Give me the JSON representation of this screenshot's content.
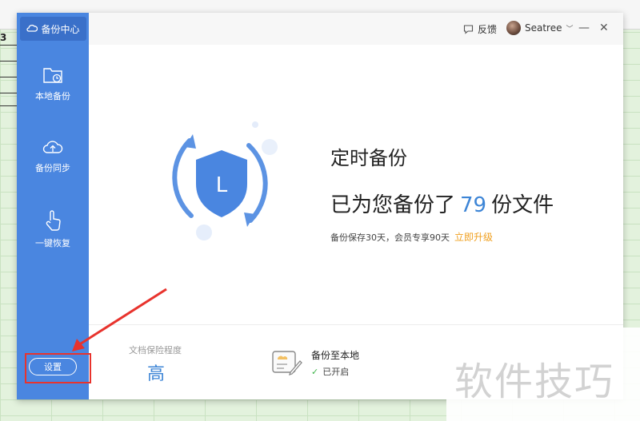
{
  "background": {
    "cell_text": "3"
  },
  "app": {
    "brand_label": "备份中心"
  },
  "sidebar": {
    "items": [
      {
        "label": "本地备份",
        "icon": "folder-clock-icon"
      },
      {
        "label": "备份同步",
        "icon": "cloud-upload-icon"
      },
      {
        "label": "一键恢复",
        "icon": "hand-tap-icon"
      }
    ],
    "settings_label": "设置"
  },
  "titlebar": {
    "feedback_label": "反馈",
    "username": "Seatree",
    "username_chevron": "﹀",
    "minimize": "—",
    "close": "✕"
  },
  "hero": {
    "title": "定时备份",
    "count_prefix": "已为您备份了",
    "count": "79",
    "count_suffix": "份文件",
    "subtitle": "备份保存30天，会员专享90天",
    "upgrade_link": "立即升级",
    "shield_letter": "L"
  },
  "footer": {
    "protection_label": "文档保险程度",
    "protection_value": "高",
    "local_backup_title": "备份至本地",
    "local_backup_status": "已开启",
    "local_backup_check": "✓"
  },
  "watermark": {
    "text": "软件技巧"
  },
  "colors": {
    "sidebar": "#4a86e0",
    "accent_blue": "#3d85d6",
    "upgrade_orange": "#f0a020",
    "check_green": "#3fb54b",
    "annotation_red": "#e8332d"
  }
}
